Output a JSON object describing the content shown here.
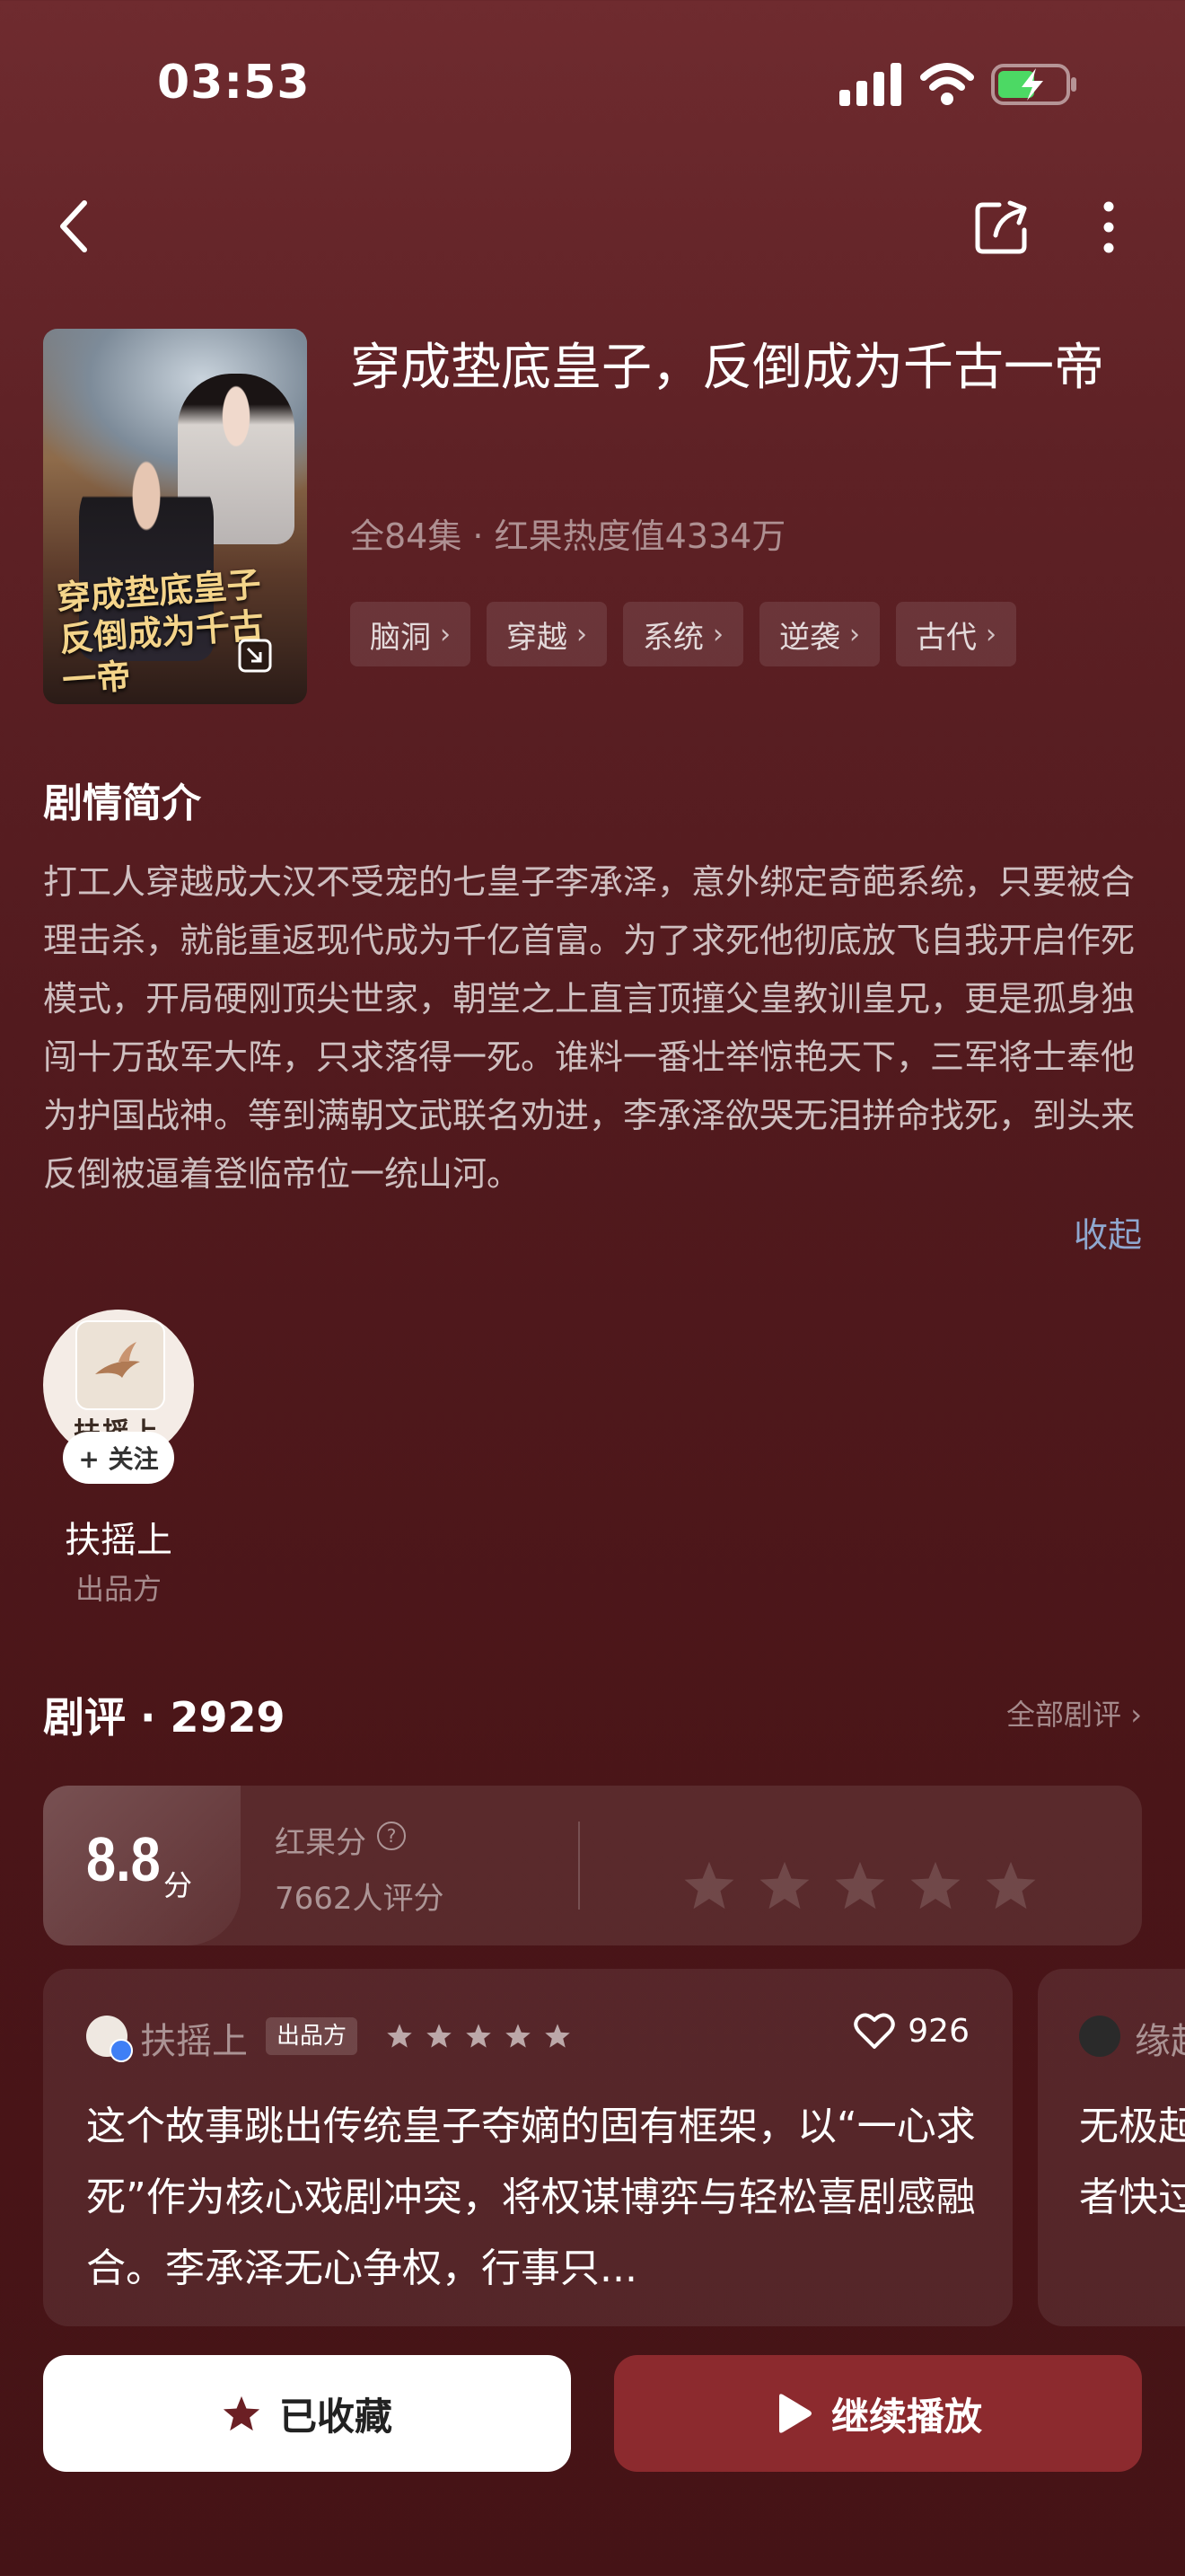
{
  "status_bar": {
    "time": "03:53"
  },
  "drama": {
    "title": "穿成垫底皇子，反倒成为千古一帝",
    "meta": "全84集 · 红果热度值4334万",
    "poster_title_line1": "穿成垫底皇子",
    "poster_title_line2": "反倒成为千古一帝",
    "tags": [
      "脑洞",
      "穿越",
      "系统",
      "逆袭",
      "古代"
    ]
  },
  "synopsis": {
    "heading": "剧情简介",
    "text": "打工人穿越成大汉不受宠的七皇子李承泽，意外绑定奇葩系统，只要被合理击杀，就能重返现代成为千亿首富。为了求死他彻底放飞自我开启作死模式，开局硬刚顶尖世家，朝堂之上直言顶撞父皇教训皇兄，更是孤身独闯十万敌军大阵，只求落得一死。谁料一番壮举惊艳天下，三军将士奉他为护国战神。等到满朝文武联名劝进，李承泽欲哭无泪拼命找死，到头来反倒被逼着登临帝位一统山河。",
    "collapse_label": "收起"
  },
  "producer": {
    "avatar_text": "扶摇上",
    "follow_label": "+ 关注",
    "name": "扶摇上",
    "role": "出品方"
  },
  "reviews": {
    "heading": "剧评 · 2929",
    "all_label": "全部剧评 ›",
    "score": "8.8",
    "score_unit": "分",
    "score_label": "红果分",
    "rating_count": "7662人评分",
    "card1": {
      "author": "扶摇上",
      "badge": "出品方",
      "rating_stars": 5,
      "likes": "926",
      "text": "这个故事跳出传统皇子夺嫡的固有框架，以“一心求死”作为核心戏剧冲突，将权谋博弈与轻松喜剧感融合。李承泽无心争权，行事只..."
    },
    "card2": {
      "author": "缘起",
      "text": "无极起\n者快过"
    }
  },
  "actions": {
    "fav_label": "已收藏",
    "play_label": "继续播放"
  },
  "colors": {
    "background": "#521a1e",
    "play_button": "#8c2a2e",
    "collapse_link": "#8fa7cf"
  }
}
